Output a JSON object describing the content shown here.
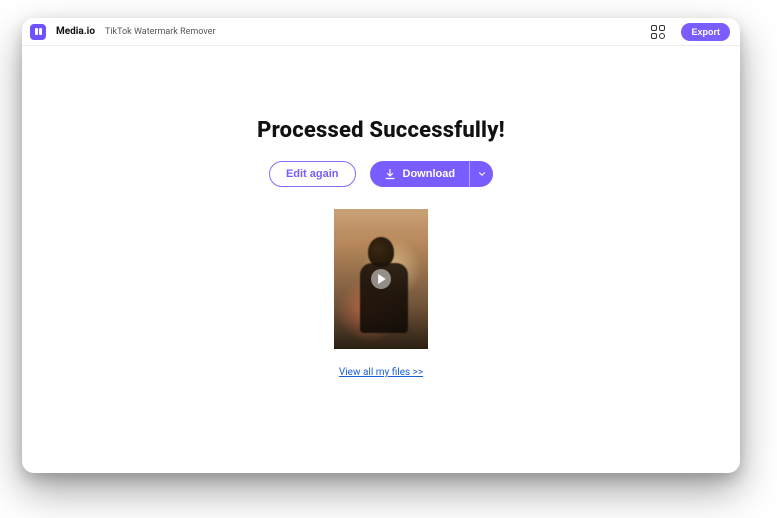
{
  "header": {
    "brand": "Media.io",
    "tool": "TikTok Watermark Remover",
    "export": "Export"
  },
  "main": {
    "title": "Processed Successfully!",
    "edit_again": "Edit again",
    "download": "Download",
    "view_files": "View all my files >>"
  },
  "icons": {
    "apps": "apps-grid-icon",
    "download": "download-icon",
    "caret": "chevron-down-icon",
    "play": "play-icon",
    "logo": "media-io-logo"
  },
  "colors": {
    "accent": "#7b5cff",
    "link": "#1a5ed6"
  }
}
